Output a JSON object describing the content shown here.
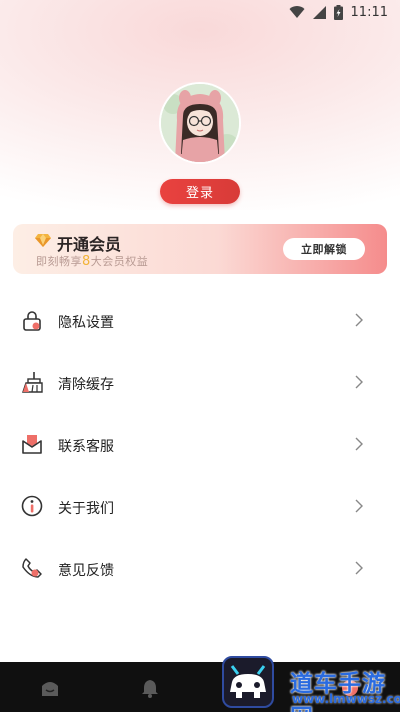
{
  "status_bar": {
    "time": "11:11"
  },
  "profile": {
    "login_label": "登录"
  },
  "vip": {
    "title": "开通会员",
    "subtitle_prefix": "即刻畅享",
    "subtitle_number": "8",
    "subtitle_suffix": "大会员权益",
    "button_label": "立即解锁"
  },
  "menu": {
    "items": [
      {
        "label": "隐私设置",
        "icon": "lock-icon"
      },
      {
        "label": "清除缓存",
        "icon": "broom-icon"
      },
      {
        "label": "联系客服",
        "icon": "mail-icon"
      },
      {
        "label": "关于我们",
        "icon": "info-icon"
      },
      {
        "label": "意见反馈",
        "icon": "phone-icon"
      }
    ]
  },
  "bottom_nav": {
    "tabs": [
      "home-icon",
      "bell-icon",
      "profile-icon"
    ]
  },
  "watermark": {
    "text": "道车手游网",
    "url": "www.lmwwsz.com"
  },
  "colors": {
    "accent": "#e0403d",
    "vip_gold": "#f2b43a"
  }
}
